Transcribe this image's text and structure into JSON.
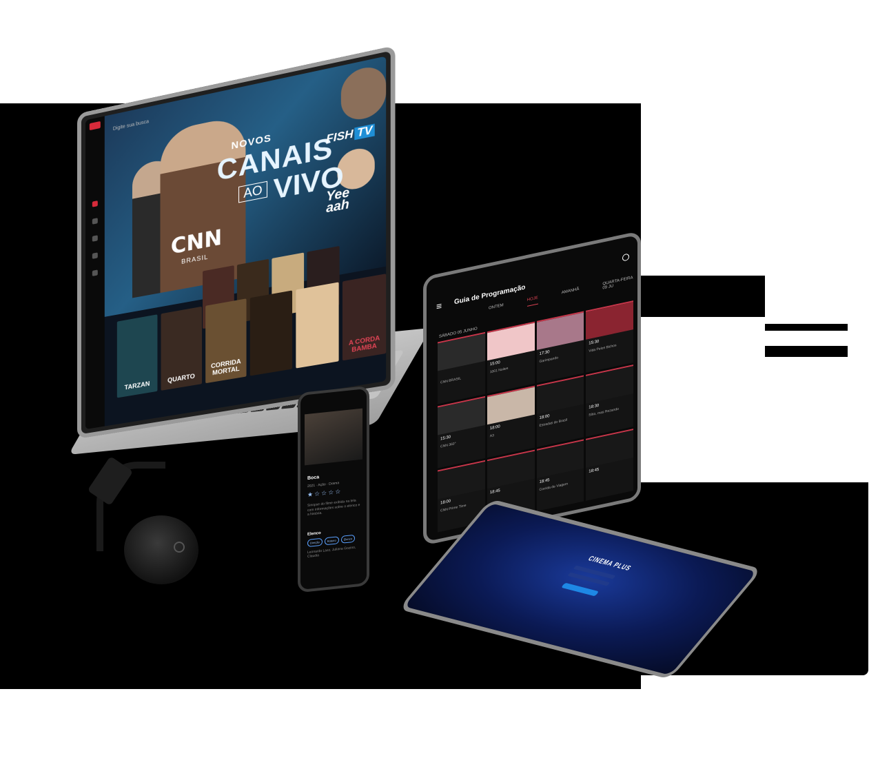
{
  "laptop": {
    "search_text": "Digite sua busca",
    "hero_kicker": "NOVOS",
    "hero_title_1": "CANAIS",
    "hero_title_ao": "AO",
    "hero_title_2": "VIVO",
    "cnn_logo": "CNN",
    "cnn_sub": "BRASIL",
    "fish_logo": "FISH",
    "fish_tv": "TV",
    "yee_logo": "Yee\naah",
    "row2": [
      "TARZAN",
      "QUARTO",
      "CORRIDA MORTAL",
      "",
      "",
      "A CORDA BAMBA"
    ]
  },
  "phone": {
    "title": "Boca",
    "meta": "2021 · Ação · Drama",
    "stars": "★☆☆☆☆",
    "description": "Sinopse do filme exibida na tela com informações sobre o elenco e a história.",
    "section": "Elenco",
    "chips": [
      "Direção",
      "Roteiro",
      "Elenco"
    ],
    "footer": "Leonardo Lazz, Juliana Gozino, Claudia"
  },
  "tablet_guide": {
    "title": "Guia de Programação",
    "tabs": [
      "ONTEM",
      "HOJE",
      "AMANHÃ",
      "QUARTA-FEIRA 09 JU"
    ],
    "date_label": "SÁBADO 05 JUNHO",
    "cells": [
      {
        "time": "",
        "name": "CNN BRASIL"
      },
      {
        "time": "15:00",
        "name": "1001 Noites"
      },
      {
        "time": "17:30",
        "name": "Garimpando"
      },
      {
        "time": "15:30",
        "name": "Vida Pelos Bichos"
      },
      {
        "time": "15:30",
        "name": "CNN 360°"
      },
      {
        "time": "18:00",
        "name": "A3"
      },
      {
        "time": "18:00",
        "name": "Estradas do Brasil"
      },
      {
        "time": "18:30",
        "name": "Sítio, mas Rezando"
      },
      {
        "time": "18:00",
        "name": "CNN Prime Time"
      },
      {
        "time": "18:45",
        "name": ""
      },
      {
        "time": "18:45",
        "name": "Corrida de Viagem"
      },
      {
        "time": "18:45",
        "name": ""
      }
    ],
    "cell_thumbs": [
      "#2a2a2a",
      "#f0c6c8",
      "#a8788a",
      "#8a2430",
      "#2a2a2a",
      "#c9b7a8",
      "#181818",
      "#181818",
      "#181818",
      "#181818",
      "#181818",
      "#181818"
    ]
  },
  "tablet_login": {
    "logo": "CINEMA PLUS"
  },
  "colors": {
    "accent_red": "#d62a3a",
    "brand_blue": "#1e88e5",
    "background": "#000000"
  }
}
